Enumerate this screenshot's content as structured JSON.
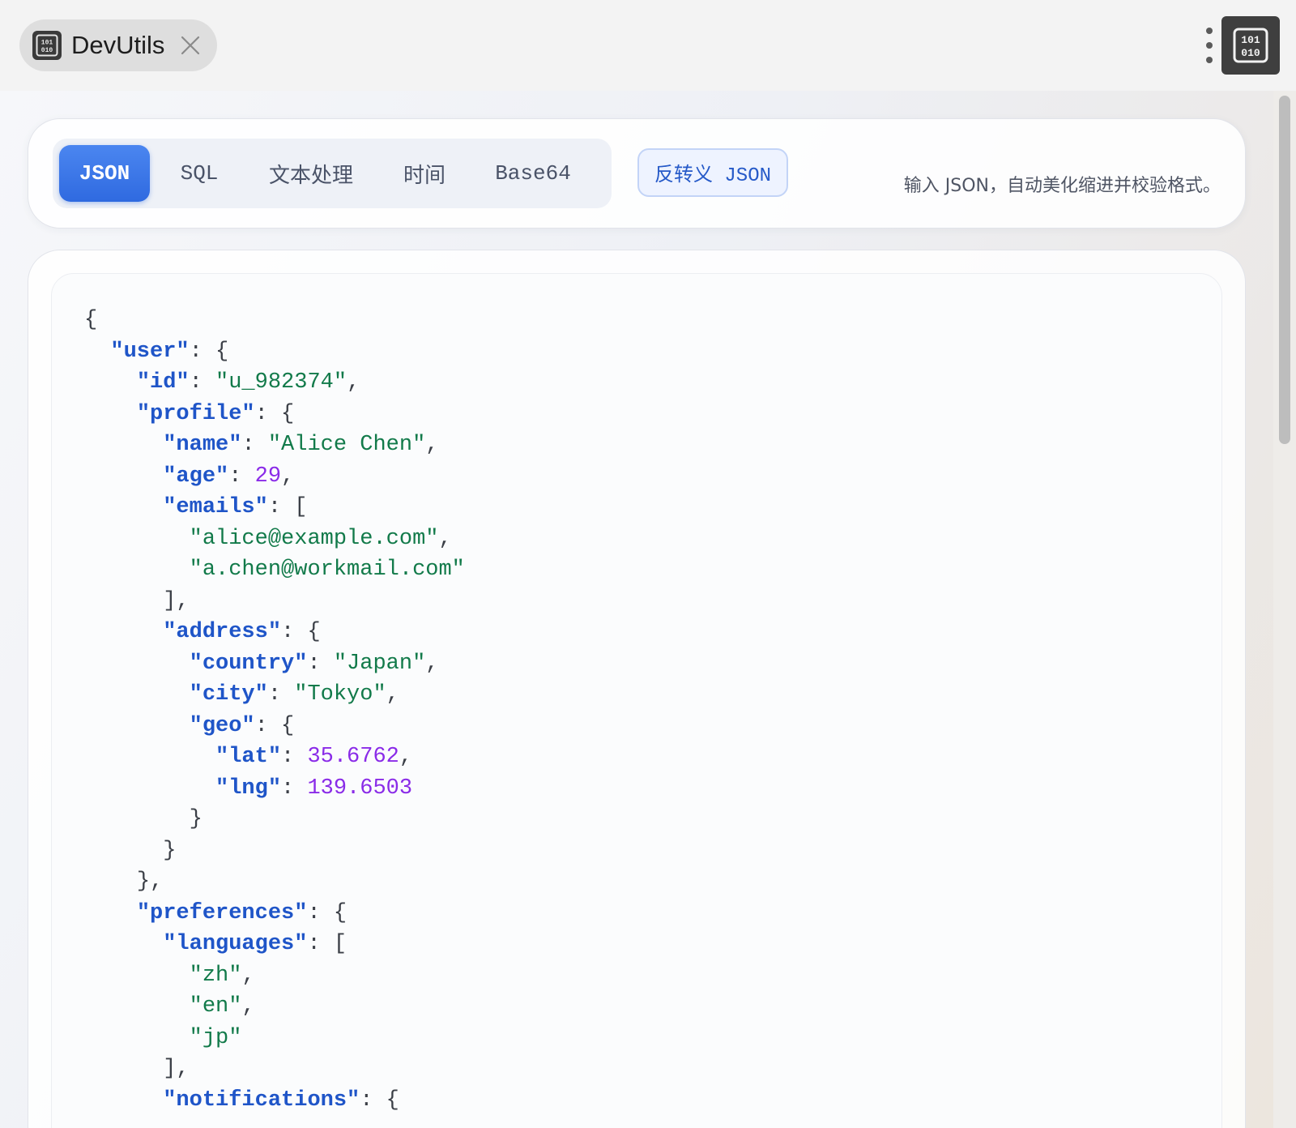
{
  "window": {
    "tab_title": "DevUtils",
    "tab_icon": "binary-app-icon",
    "close_icon": "close-icon",
    "menu_icon": "kebab-menu-icon",
    "extension_icon": "binary-extension-icon"
  },
  "toolbar": {
    "tabs": [
      {
        "label": "JSON",
        "active": true
      },
      {
        "label": "SQL",
        "active": false
      },
      {
        "label": "文本处理",
        "active": false
      },
      {
        "label": "时间",
        "active": false
      },
      {
        "label": "Base64",
        "active": false
      }
    ],
    "unescape_label": "反转义 JSON",
    "hint": "输入 JSON，自动美化缩进并校验格式。"
  },
  "colors": {
    "accent": "#2f6ae0",
    "json_key": "#1f55c8",
    "json_string": "#127a4a",
    "json_number": "#8a2be8",
    "punctuation": "#3b3f47"
  },
  "editor": {
    "lines": [
      {
        "indent": 0,
        "tokens": [
          {
            "t": "punc",
            "v": "{"
          }
        ]
      },
      {
        "indent": 1,
        "tokens": [
          {
            "t": "key",
            "v": "\"user\""
          },
          {
            "t": "punc",
            "v": ": {"
          }
        ]
      },
      {
        "indent": 2,
        "tokens": [
          {
            "t": "key",
            "v": "\"id\""
          },
          {
            "t": "punc",
            "v": ": "
          },
          {
            "t": "str",
            "v": "\"u_982374\""
          },
          {
            "t": "punc",
            "v": ","
          }
        ]
      },
      {
        "indent": 2,
        "tokens": [
          {
            "t": "key",
            "v": "\"profile\""
          },
          {
            "t": "punc",
            "v": ": {"
          }
        ]
      },
      {
        "indent": 3,
        "tokens": [
          {
            "t": "key",
            "v": "\"name\""
          },
          {
            "t": "punc",
            "v": ": "
          },
          {
            "t": "str",
            "v": "\"Alice Chen\""
          },
          {
            "t": "punc",
            "v": ","
          }
        ]
      },
      {
        "indent": 3,
        "tokens": [
          {
            "t": "key",
            "v": "\"age\""
          },
          {
            "t": "punc",
            "v": ": "
          },
          {
            "t": "num",
            "v": "29"
          },
          {
            "t": "punc",
            "v": ","
          }
        ]
      },
      {
        "indent": 3,
        "tokens": [
          {
            "t": "key",
            "v": "\"emails\""
          },
          {
            "t": "punc",
            "v": ": ["
          }
        ]
      },
      {
        "indent": 4,
        "tokens": [
          {
            "t": "str",
            "v": "\"alice@example.com\""
          },
          {
            "t": "punc",
            "v": ","
          }
        ]
      },
      {
        "indent": 4,
        "tokens": [
          {
            "t": "str",
            "v": "\"a.chen@workmail.com\""
          }
        ]
      },
      {
        "indent": 3,
        "tokens": [
          {
            "t": "punc",
            "v": "],"
          }
        ]
      },
      {
        "indent": 3,
        "tokens": [
          {
            "t": "key",
            "v": "\"address\""
          },
          {
            "t": "punc",
            "v": ": {"
          }
        ]
      },
      {
        "indent": 4,
        "tokens": [
          {
            "t": "key",
            "v": "\"country\""
          },
          {
            "t": "punc",
            "v": ": "
          },
          {
            "t": "str",
            "v": "\"Japan\""
          },
          {
            "t": "punc",
            "v": ","
          }
        ]
      },
      {
        "indent": 4,
        "tokens": [
          {
            "t": "key",
            "v": "\"city\""
          },
          {
            "t": "punc",
            "v": ": "
          },
          {
            "t": "str",
            "v": "\"Tokyo\""
          },
          {
            "t": "punc",
            "v": ","
          }
        ]
      },
      {
        "indent": 4,
        "tokens": [
          {
            "t": "key",
            "v": "\"geo\""
          },
          {
            "t": "punc",
            "v": ": {"
          }
        ]
      },
      {
        "indent": 5,
        "tokens": [
          {
            "t": "key",
            "v": "\"lat\""
          },
          {
            "t": "punc",
            "v": ": "
          },
          {
            "t": "num",
            "v": "35.6762"
          },
          {
            "t": "punc",
            "v": ","
          }
        ]
      },
      {
        "indent": 5,
        "tokens": [
          {
            "t": "key",
            "v": "\"lng\""
          },
          {
            "t": "punc",
            "v": ": "
          },
          {
            "t": "num",
            "v": "139.6503"
          }
        ]
      },
      {
        "indent": 4,
        "tokens": [
          {
            "t": "punc",
            "v": "}"
          }
        ]
      },
      {
        "indent": 3,
        "tokens": [
          {
            "t": "punc",
            "v": "}"
          }
        ]
      },
      {
        "indent": 2,
        "tokens": [
          {
            "t": "punc",
            "v": "},"
          }
        ]
      },
      {
        "indent": 2,
        "tokens": [
          {
            "t": "key",
            "v": "\"preferences\""
          },
          {
            "t": "punc",
            "v": ": {"
          }
        ]
      },
      {
        "indent": 3,
        "tokens": [
          {
            "t": "key",
            "v": "\"languages\""
          },
          {
            "t": "punc",
            "v": ": ["
          }
        ]
      },
      {
        "indent": 4,
        "tokens": [
          {
            "t": "str",
            "v": "\"zh\""
          },
          {
            "t": "punc",
            "v": ","
          }
        ]
      },
      {
        "indent": 4,
        "tokens": [
          {
            "t": "str",
            "v": "\"en\""
          },
          {
            "t": "punc",
            "v": ","
          }
        ]
      },
      {
        "indent": 4,
        "tokens": [
          {
            "t": "str",
            "v": "\"jp\""
          }
        ]
      },
      {
        "indent": 3,
        "tokens": [
          {
            "t": "punc",
            "v": "],"
          }
        ]
      },
      {
        "indent": 3,
        "tokens": [
          {
            "t": "key",
            "v": "\"notifications\""
          },
          {
            "t": "punc",
            "v": ": {"
          }
        ]
      }
    ]
  }
}
